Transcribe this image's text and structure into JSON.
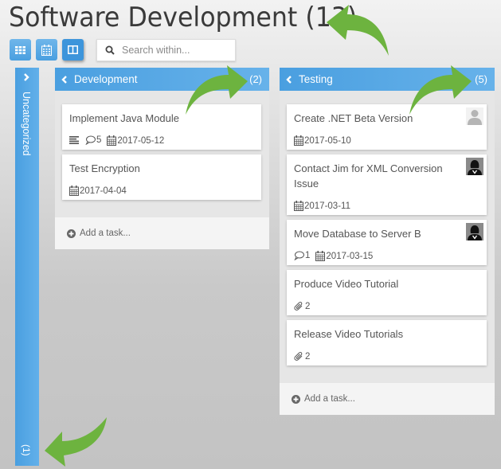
{
  "header": {
    "title": "Software Development (13)"
  },
  "toolbar": {
    "views": [
      {
        "name": "grid-view",
        "icon": "grid-icon",
        "active": false
      },
      {
        "name": "calendar-view",
        "icon": "calendar-icon",
        "active": false
      },
      {
        "name": "board-view",
        "icon": "columns-icon",
        "active": true
      }
    ],
    "search": {
      "placeholder": "Search within...",
      "value": ""
    }
  },
  "collapsed_column": {
    "label": "Uncategorized",
    "count": "(1)"
  },
  "columns": [
    {
      "title": "Development",
      "count": "(2)",
      "add_task_label": "Add a task...",
      "cards": [
        {
          "title": "Implement Java Module",
          "has_description": true,
          "comments": "5",
          "date": "2017-05-12"
        },
        {
          "title": "Test Encryption",
          "date": "2017-04-04"
        }
      ]
    },
    {
      "title": "Testing",
      "count": "(5)",
      "add_task_label": "Add a task...",
      "cards": [
        {
          "title": "Create .NET Beta Version",
          "date": "2017-05-10",
          "avatar": "generic-user"
        },
        {
          "title": "Contact Jim for XML Conversion Issue",
          "date": "2017-03-11",
          "avatar": "female-user"
        },
        {
          "title": "Move Database to Server B",
          "comments": "1",
          "date": "2017-03-15",
          "avatar": "female-user"
        },
        {
          "title": "Produce Video Tutorial",
          "attachments": "2"
        },
        {
          "title": "Release Video Tutorials",
          "attachments": "2"
        }
      ]
    }
  ],
  "colors": {
    "accent": "#4a9fe0",
    "annotation_arrow": "#6db33f"
  }
}
